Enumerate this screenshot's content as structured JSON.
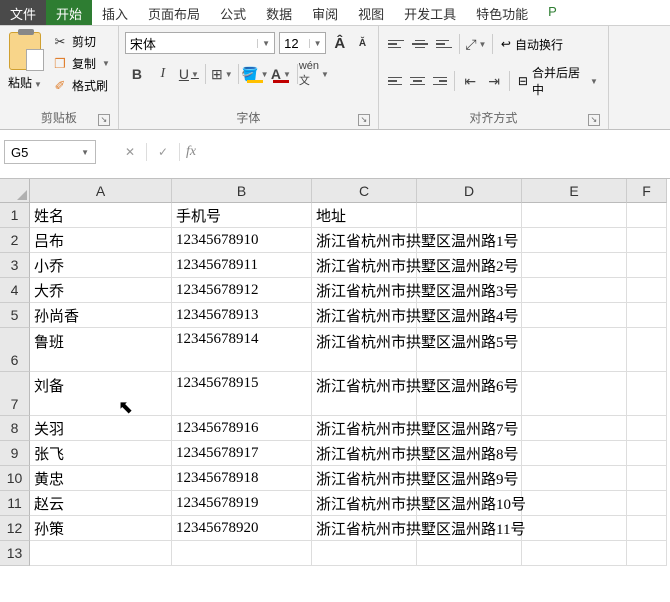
{
  "menu": {
    "file": "文件",
    "home": "开始",
    "insert": "插入",
    "layout": "页面布局",
    "formulas": "公式",
    "data": "数据",
    "review": "审阅",
    "view": "视图",
    "dev": "开发工具",
    "special": "特色功能",
    "p": "P"
  },
  "clipboard": {
    "paste": "粘贴",
    "cut": "剪切",
    "copy": "复制",
    "brush": "格式刷",
    "group": "剪贴板"
  },
  "font": {
    "name": "宋体",
    "size": "12",
    "group": "字体"
  },
  "align": {
    "wrap": "自动换行",
    "merge": "合并后居中",
    "group": "对齐方式"
  },
  "namebox": "G5",
  "headers": {
    "A": "A",
    "B": "B",
    "C": "C",
    "D": "D",
    "E": "E",
    "F": "F"
  },
  "rows": [
    {
      "n": "1",
      "h": "norm",
      "a": "姓名",
      "b": "手机号",
      "c": "地址"
    },
    {
      "n": "2",
      "h": "norm",
      "a": "吕布",
      "b": "12345678910",
      "c": "浙江省杭州市拱墅区温州路1号"
    },
    {
      "n": "3",
      "h": "norm",
      "a": "小乔",
      "b": "12345678911",
      "c": "浙江省杭州市拱墅区温州路2号"
    },
    {
      "n": "4",
      "h": "norm",
      "a": "大乔",
      "b": "12345678912",
      "c": "浙江省杭州市拱墅区温州路3号"
    },
    {
      "n": "5",
      "h": "norm",
      "a": "孙尚香",
      "b": "12345678913",
      "c": "浙江省杭州市拱墅区温州路4号"
    },
    {
      "n": "6",
      "h": "tall",
      "a": "鲁班",
      "b": "12345678914",
      "c": "浙江省杭州市拱墅区温州路5号"
    },
    {
      "n": "7",
      "h": "tall",
      "a": "刘备",
      "b": "12345678915",
      "c": "浙江省杭州市拱墅区温州路6号"
    },
    {
      "n": "8",
      "h": "norm",
      "a": "关羽",
      "b": "12345678916",
      "c": "浙江省杭州市拱墅区温州路7号"
    },
    {
      "n": "9",
      "h": "norm",
      "a": "张飞",
      "b": "12345678917",
      "c": "浙江省杭州市拱墅区温州路8号"
    },
    {
      "n": "10",
      "h": "norm",
      "a": "黄忠",
      "b": "12345678918",
      "c": "浙江省杭州市拱墅区温州路9号"
    },
    {
      "n": "11",
      "h": "norm",
      "a": "赵云",
      "b": "12345678919",
      "c": "浙江省杭州市拱墅区温州路10号"
    },
    {
      "n": "12",
      "h": "norm",
      "a": "孙策",
      "b": "12345678920",
      "c": "浙江省杭州市拱墅区温州路11号"
    },
    {
      "n": "13",
      "h": "norm",
      "a": "",
      "b": "",
      "c": ""
    }
  ]
}
